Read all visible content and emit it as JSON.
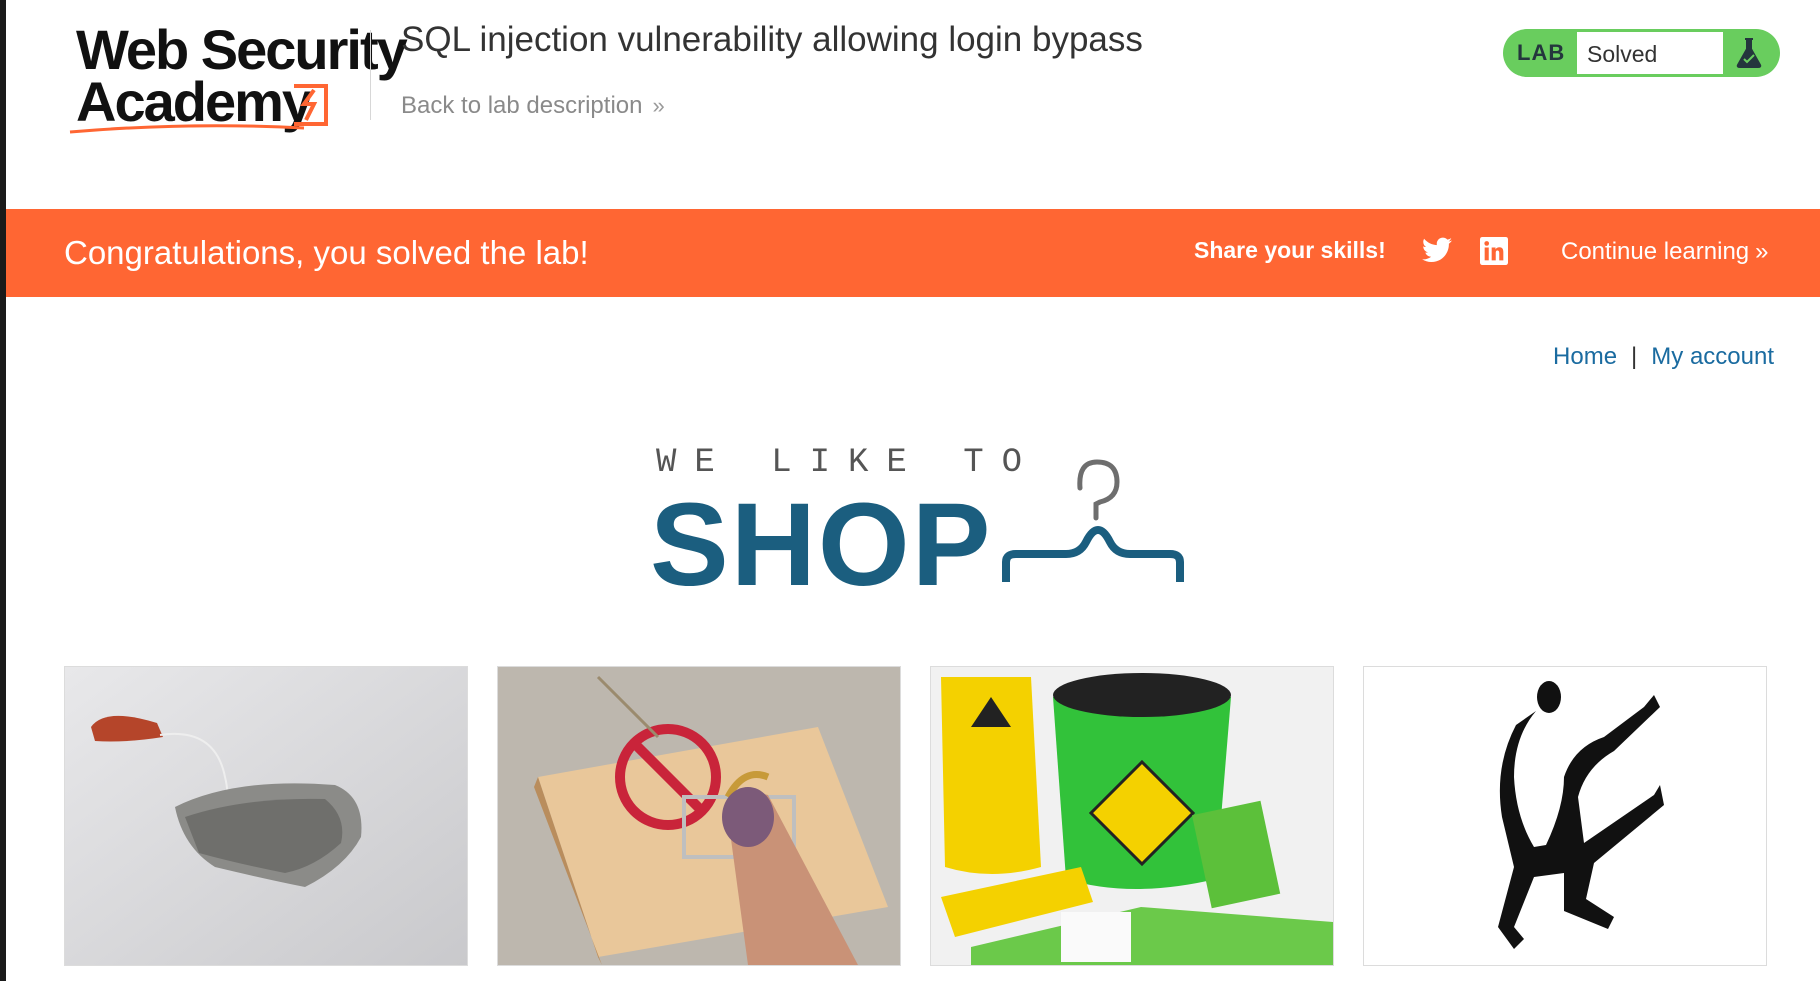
{
  "header": {
    "logo": {
      "line1": "Web Security",
      "line2": "Academy"
    },
    "lab_title": "SQL injection vulnerability allowing login bypass",
    "back_link": "Back to lab description",
    "status": {
      "tag": "LAB",
      "value": "Solved",
      "icon": "flask-icon"
    }
  },
  "banner": {
    "message": "Congratulations, you solved the lab!",
    "share_label": "Share your skills!",
    "twitter_icon": "twitter-icon",
    "linkedin_icon": "linkedin-icon",
    "continue_label": "Continue learning"
  },
  "nav": {
    "home": "Home",
    "separator": "|",
    "account": "My account"
  },
  "shop_logo": {
    "tagline": "WE LIKE TO",
    "title": "SHOP",
    "icon": "hanger-icon"
  },
  "products": [
    {
      "image": "tea-bag-image"
    },
    {
      "image": "mousetrap-image"
    },
    {
      "image": "bucket-of-doom-image"
    },
    {
      "image": "dancing-silhouette-image"
    }
  ],
  "colors": {
    "brand_orange": "#ff6633",
    "solved_green": "#69cd5e",
    "shop_blue": "#1b5e7f",
    "link_blue": "#1a6ba0"
  }
}
